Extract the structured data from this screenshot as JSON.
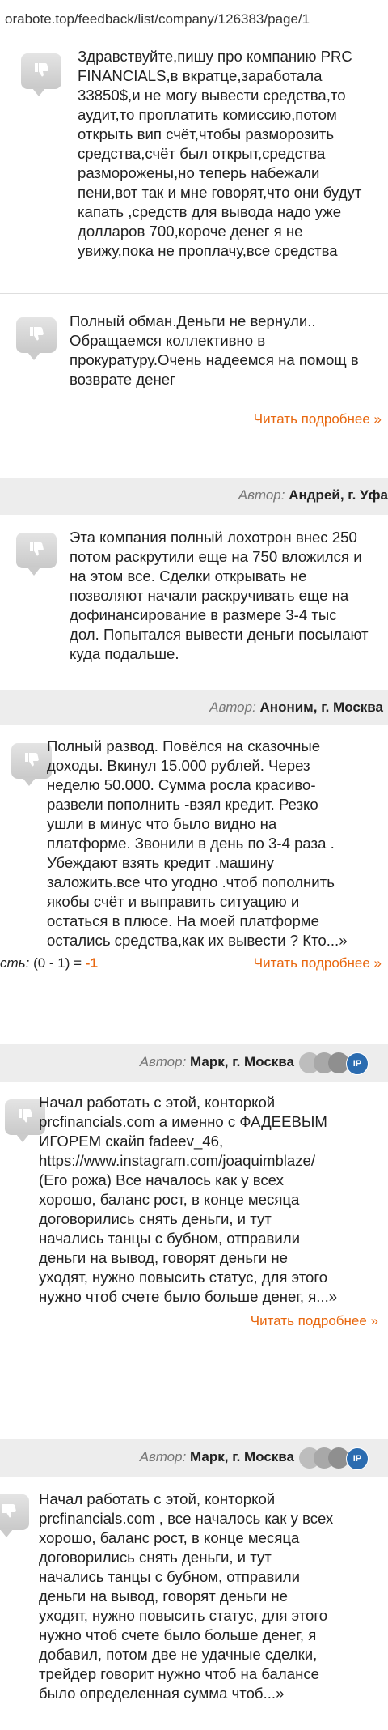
{
  "browser": {
    "url": "orabote.top/feedback/list/company/126383/page/1"
  },
  "reviews": [
    {
      "text": "Здравствуйте,пишу про компанию PRC\nFINANCIALS,в вкратце,заработала\n33850$,и не могу вывести средства,то\nаудит,то проплатить комиссию,потом\nоткрыть вип счёт,чтобы разморозить\nсредства,счёт был открыт,средства\nразморожены,но теперь набежали\nпени,вот так и мне говорят,что они будут\nкапать ,средств для вывода надо уже\nдолларов 700,короче денег я не\nувижу,пока не проплачу,все средства"
    },
    {
      "text": "Полный обман.Деньги не вернули..\nОбращаемся коллективно в\nпрокуратуру.Очень надеемся на помощ в\nвозврате денег",
      "more": "Читать подробнее »"
    },
    {
      "author_label": "Автор:",
      "author_name": "Андрей, г. Уфа",
      "text": "Эта компания полный лохотрон внес 250\nпотом раскрутили еще на 750 вложился и\nна этом все. Сделки открывать не\nпозволяют начали раскручивать еще на\nдофинансирование в размере 3-4 тыс\nдол. Попытался вывести деньги посылают\nкуда подальше."
    },
    {
      "author_label": "Автор:",
      "author_name": "Аноним, г. Москва",
      "text": "Полный развод. Повёлся на сказочные\nдоходы. Вкинул 15.000 рублей. Через\nнеделю 50.000. Сумма росла красиво-\nразвели пополнить -взял кредит. Резко\nушли в минус что было видно на\nплатформе. Звонили в день по 3-4 раза .\nУбеждают взять кредит .машину\nзаложить.все что угодно .чтоб пополнить\nякобы счёт и выправить ситуацию и\nостаться в плюсе. На моей платформе\nостались средства,как их вывести ? Кто...»",
      "score_label": "сть:",
      "score_expr": "(0 - 1) =",
      "score_value": "-1",
      "more": "Читать подробнее »"
    },
    {
      "author_label": "Автор:",
      "author_name": "Марк, г. Москва",
      "badge": "IP",
      "text": "Начал работать с этой, конторкой\nprcfinancials.com а именно с ФАДЕЕВЫМ\nИГОРЕМ скайп fadeev_46,\nhttps://www.instagram.com/joaquimblaze/\n(Его рожа) Все началось как у всех\nхорошо, баланс рост, в конце месяца\nдоговорились снять деньги, и тут\nначались танцы с бубном, отправили\nденьги на вывод, говорят деньги не\nуходят, нужно повысить статус, для этого\nнужно чтоб счете было больше денег, я...»",
      "more": "Читать подробнее »"
    },
    {
      "author_label": "Автор:",
      "author_name": "Марк, г. Москва",
      "badge": "IP",
      "text": "Начал работать с этой, конторкой\nprcfinancials.com , все началось как у всех\nхорошо, баланс рост, в конце месяца\nдоговорились снять деньги, и тут\nначались танцы с бубном, отправили\nденьги на вывод, говорят деньги не\nуходят, нужно повысить статус, для этого\nнужно чтоб счете было больше денег, я\nдобавил, потом две не удачные сделки,\nтрейдер говорит нужно чтоб на балансе\nбыло определенная сумма чтоб...»"
    }
  ],
  "colors": {
    "link": "#e8670f",
    "band": "#ededed",
    "badge": "#2b6cb0"
  },
  "icons": {
    "review_icon": "thumbs-down-icon",
    "rating_dots": "rating-dots-icon"
  }
}
